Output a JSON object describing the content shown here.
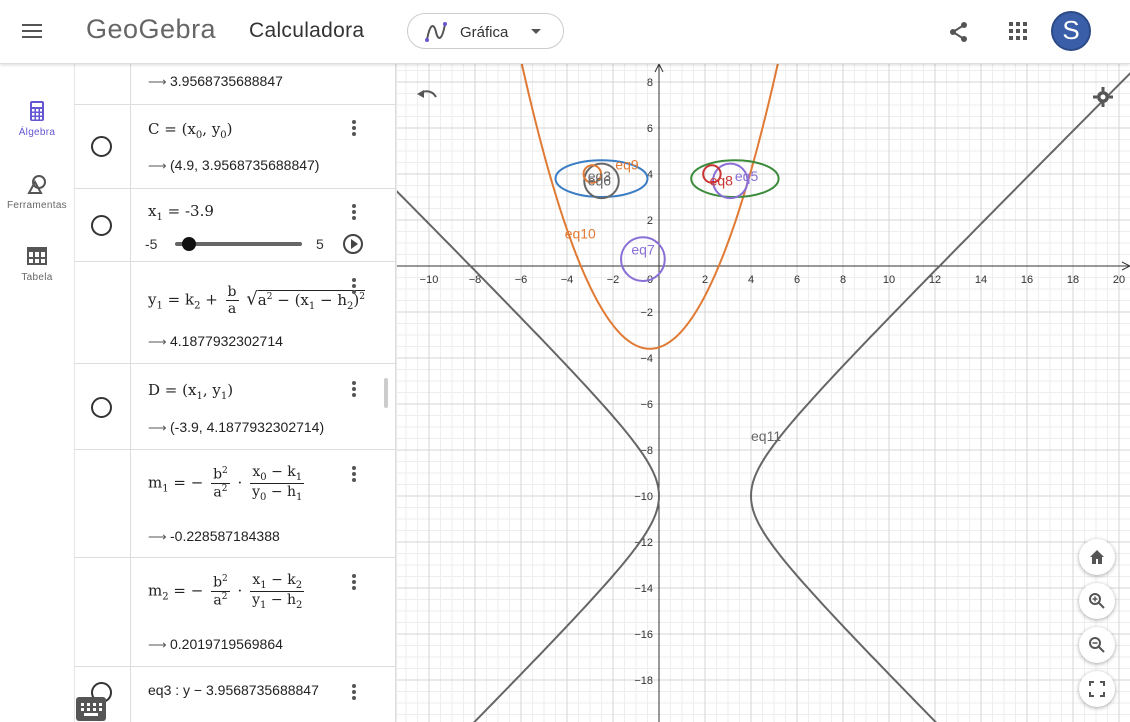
{
  "header": {
    "app_title": "Calculadora",
    "view_selector": {
      "label": "Gráfica"
    },
    "avatar_letter": "S"
  },
  "sidebar": {
    "items": [
      {
        "label": "Álgebra",
        "icon": "calculator-icon",
        "active": true
      },
      {
        "label": "Ferramentas",
        "icon": "tools-icon",
        "active": false
      },
      {
        "label": "Tabela",
        "icon": "table-icon",
        "active": false
      }
    ]
  },
  "algebra": {
    "row0_output": "3.9568735688847",
    "c_output": "(4.9, 3.9568735688847)",
    "slider": {
      "min": "-5",
      "max": "5",
      "value": -3.9,
      "value_text": "-3.9"
    },
    "y1_output": "4.1877932302714",
    "d_output": "(-3.9, 4.1877932302714)",
    "m1_output": "-0.228587184388",
    "m2_output": "0.2019719569864",
    "eq3_text": "eq3 : y − 3.9568735688847"
  },
  "graphics": {
    "x_ticks": [
      "−10",
      "−8",
      "−6",
      "−4",
      "−2",
      "0",
      "2",
      "4",
      "6",
      "8",
      "10",
      "12",
      "14",
      "16",
      "18",
      "20"
    ],
    "y_ticks": [
      "8",
      "6",
      "4",
      "2",
      "−2",
      "−4",
      "−6",
      "−8",
      "−10",
      "−12",
      "−14",
      "−16",
      "−18"
    ],
    "labels": [
      "eq6",
      "eq7",
      "eq8",
      "eq9",
      "eq10",
      "eq11",
      "eq3",
      "eq5"
    ],
    "colors": {
      "parabola": "#e07a34",
      "hyperbola": "#666666",
      "blue": "#3b7dc4",
      "green": "#3b8b3b",
      "purple": "#8a6fd6",
      "red": "#cc3333",
      "accent": "#6557d2"
    }
  }
}
